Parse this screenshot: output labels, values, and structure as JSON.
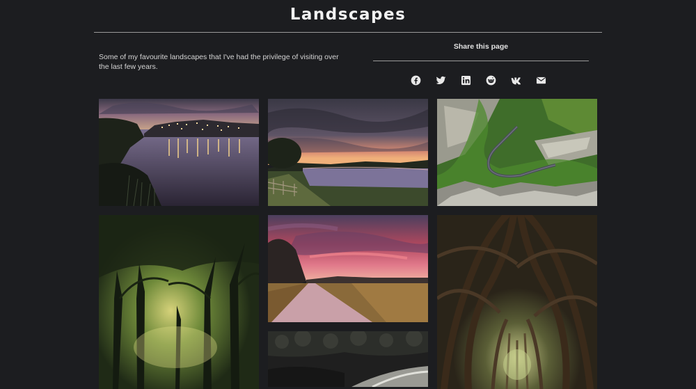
{
  "page": {
    "title": "Landscapes",
    "intro": "Some of my favourite landscapes that I've had the privilege of visiting over the last few years."
  },
  "share": {
    "title": "Share this page",
    "icons": [
      "facebook-icon",
      "twitter-icon",
      "linkedin-icon",
      "reddit-icon",
      "vk-icon",
      "email-icon"
    ]
  },
  "gallery": {
    "photos": [
      {
        "subject": "lakeside-town-at-dusk"
      },
      {
        "subject": "sunset-over-lake-stormy-sky"
      },
      {
        "subject": "winding-road-through-gorge"
      },
      {
        "subject": "sunlit-forest"
      },
      {
        "subject": "path-under-pink-sunset"
      },
      {
        "subject": "tree-tunnel-lane"
      },
      {
        "subject": "dark-river-rapids"
      }
    ]
  },
  "colors": {
    "background": "#1c1d20",
    "text": "#e6e6e6",
    "rule": "#9a9a9a"
  }
}
